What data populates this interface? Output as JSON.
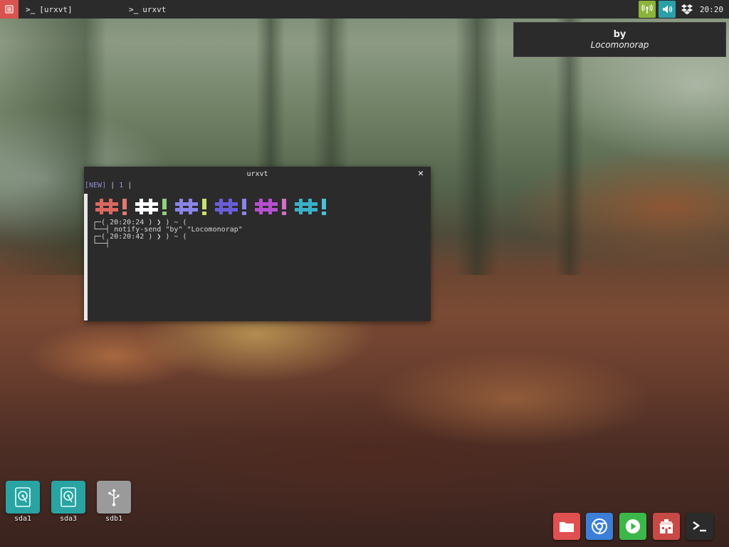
{
  "panel": {
    "menu_icon": "app-menu-icon",
    "tasks": [
      {
        "label": "[urxvt]",
        "icon": "terminal-icon"
      },
      {
        "label": "urxvt",
        "icon": "terminal-icon"
      }
    ],
    "tray": {
      "network_icon": "network-signal-icon",
      "volume_icon": "volume-icon",
      "dropbox_icon": "dropbox-icon",
      "clock": "20:20"
    }
  },
  "notification": {
    "title": "by",
    "body": "Locomonorap"
  },
  "terminal": {
    "title": "urxvt",
    "tabbar": {
      "new_label": "[NEW]",
      "sep1": " | ",
      "tab1": "1",
      "sep2": " |"
    },
    "color_blocks": [
      {
        "color": "#d9685e",
        "bang": "#e07a70"
      },
      {
        "color": "#ffffff",
        "bang": "#8fd07e"
      },
      {
        "color": "#8a84e8",
        "bang": "#c8e070"
      },
      {
        "color": "#6a5ed8",
        "bang": "#8a84e8"
      },
      {
        "color": "#b64fd0",
        "bang": "#d070c8"
      },
      {
        "color": "#3ab0c8",
        "bang": "#4ac0d8"
      }
    ],
    "lines": [
      "┌─( 20:20:24 ) ❯ ) ~ (",
      "└──┤ notify-send \"by\" \"Locomonorap\"",
      "┌─( 20:20:42 ) ❯ ) ~ (",
      "└──┤"
    ]
  },
  "desktop_icons": [
    {
      "label": "sda1",
      "icon": "hard-drive-icon",
      "color": "#2aa3a3"
    },
    {
      "label": "sda3",
      "icon": "hard-drive-icon",
      "color": "#2aa3a3"
    },
    {
      "label": "sdb1",
      "icon": "usb-drive-icon",
      "color": "#9a9a9a"
    }
  ],
  "dock": [
    {
      "name": "file-manager",
      "icon": "folder-icon",
      "color": "#e05050"
    },
    {
      "name": "chromium",
      "icon": "chromium-icon",
      "color": "#3d7fd8"
    },
    {
      "name": "media-player",
      "icon": "play-icon",
      "color": "#3cb84a"
    },
    {
      "name": "software-store",
      "icon": "store-icon",
      "color": "#c84a46"
    },
    {
      "name": "terminal",
      "icon": "terminal-icon",
      "color": "#2b2b2b"
    }
  ]
}
